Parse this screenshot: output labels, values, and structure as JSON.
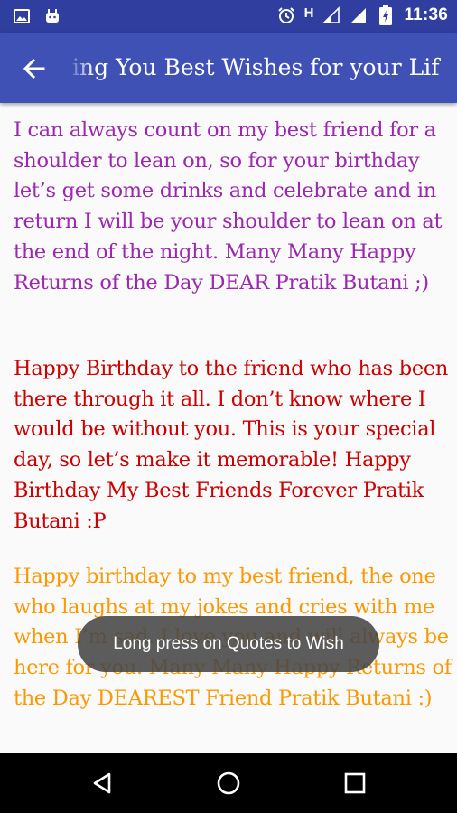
{
  "status_bar": {
    "time": "11:36",
    "network_letter": "H",
    "left_icons": [
      "image-icon",
      "android-icon"
    ],
    "right_icons": [
      "alarm-icon",
      "signal-icon",
      "signal-icon",
      "battery-icon"
    ]
  },
  "app_bar": {
    "title": "ing You Best Wishes for your Lif",
    "back_icon": "arrow-back-icon",
    "color": "#3f51b5",
    "status_color": "#303f9f"
  },
  "quotes": [
    {
      "text": "I can always count on my best friend for a shoulder to lean on, so for your birthday let’s get some drinks and celebrate and in return I will be your shoulder to lean on at the end of the night. Many Many Happy Returns of the Day DEAR Pratik Butani ;)",
      "color": "#9c27b0"
    },
    {
      "text": "Happy Birthday to the friend who has been there through it all. I don’t know where I would be without you. This is your special day, so let’s make it memorable! Happy Birthday My Best Friends Forever Pratik Butani :P",
      "color": "#cc0000"
    },
    {
      "text": "Happy birthday to my best friend, the one who laughs at my jokes and cries with me when I’m sad. I love you and will always be here for you. Many Many Happy Returns of the Day DEAREST Friend Pratik Butani :)",
      "color": "#ff9800"
    }
  ],
  "toast": {
    "text": "Long press on Quotes to Wish"
  },
  "nav_bar": {
    "buttons": [
      "back-triangle-icon",
      "home-circle-icon",
      "recents-square-icon"
    ]
  }
}
